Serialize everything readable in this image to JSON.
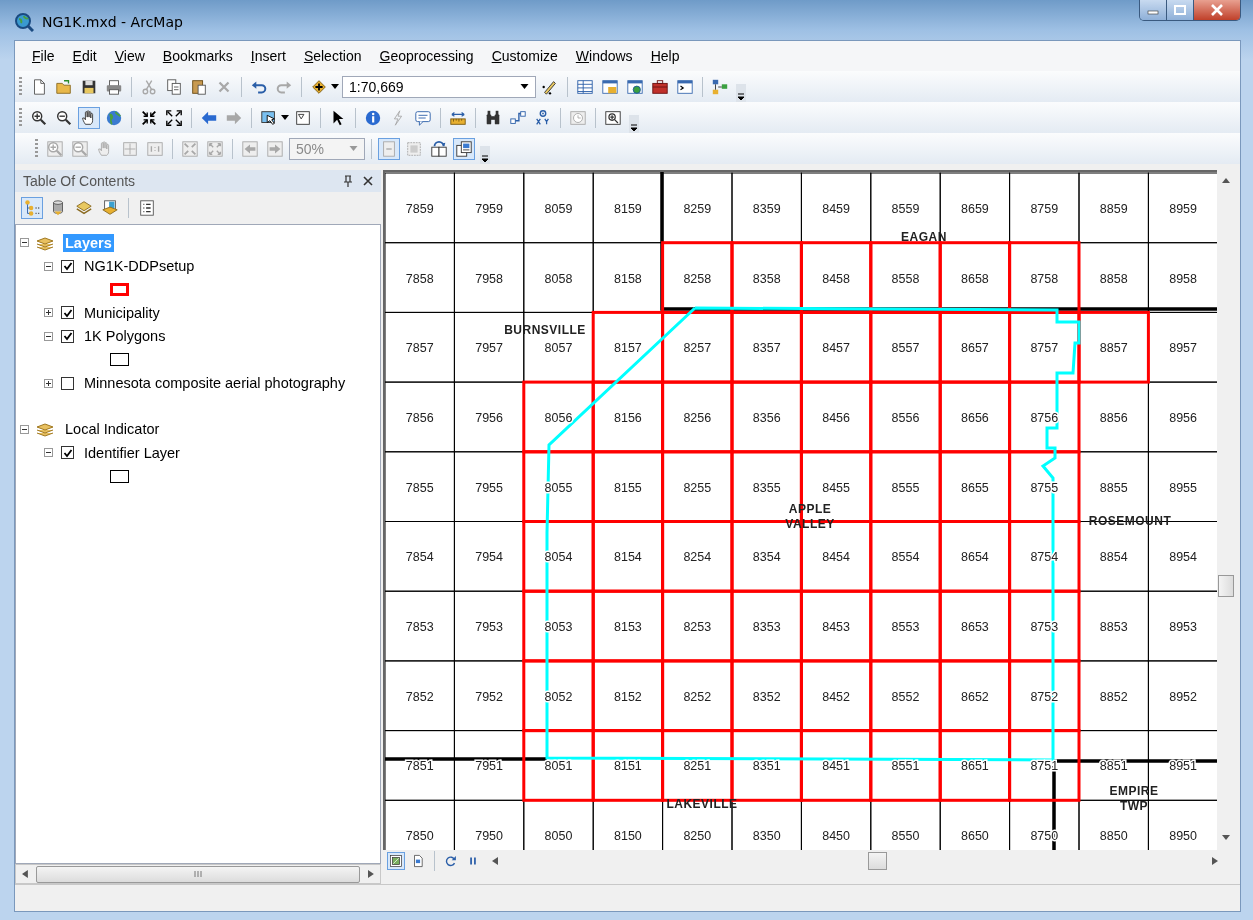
{
  "window": {
    "title": "NG1K.mxd - ArcMap"
  },
  "menu": [
    {
      "label": "File"
    },
    {
      "label": "Edit"
    },
    {
      "label": "View"
    },
    {
      "label": "Bookmarks"
    },
    {
      "label": "Insert"
    },
    {
      "label": "Selection"
    },
    {
      "label": "Geoprocessing"
    },
    {
      "label": "Customize"
    },
    {
      "label": "Windows"
    },
    {
      "label": "Help"
    }
  ],
  "standard_toolbar": {
    "scale": "1:70,669"
  },
  "layout_toolbar": {
    "zoom": "50%"
  },
  "toc": {
    "title": "Table Of Contents",
    "items": [
      {
        "label": "Layers",
        "kind": "group",
        "selected": true,
        "expanded": true,
        "children": [
          {
            "label": "NG1K-DDPsetup",
            "kind": "layer",
            "checked": true,
            "expanded": true,
            "children": [
              {
                "kind": "symbol",
                "color": "#ff0000"
              }
            ]
          },
          {
            "label": "Municipality",
            "kind": "layer",
            "checked": true,
            "expanded": false
          },
          {
            "label": "1K Polygons",
            "kind": "layer",
            "checked": true,
            "expanded": true,
            "children": [
              {
                "kind": "symbol",
                "color": "#000000"
              }
            ]
          },
          {
            "label": "Minnesota composite aerial photography",
            "kind": "layer",
            "checked": false,
            "expanded": false
          }
        ]
      },
      {
        "label": "Local Indicator",
        "kind": "group",
        "selected": false,
        "expanded": true,
        "children": [
          {
            "label": "Identifier Layer",
            "kind": "layer",
            "checked": true,
            "expanded": true,
            "children": [
              {
                "kind": "symbol",
                "color": "#000000"
              }
            ]
          }
        ]
      }
    ]
  },
  "map": {
    "rows": [
      {
        "labels": [
          "7859",
          "7959",
          "8059",
          "8159",
          "8259",
          "8359",
          "8459",
          "8559",
          "8659",
          "8759",
          "8859",
          "8959"
        ],
        "highlighted": [
          false,
          false,
          false,
          false,
          false,
          false,
          false,
          false,
          false,
          false,
          false,
          false
        ]
      },
      {
        "labels": [
          "7858",
          "7958",
          "8058",
          "8158",
          "8258",
          "8358",
          "8458",
          "8558",
          "8658",
          "8758",
          "8858",
          "8958"
        ],
        "highlighted": [
          false,
          false,
          false,
          false,
          true,
          true,
          true,
          true,
          true,
          true,
          false,
          false
        ]
      },
      {
        "labels": [
          "7857",
          "7957",
          "8057",
          "8157",
          "8257",
          "8357",
          "8457",
          "8557",
          "8657",
          "8757",
          "8857",
          "8957"
        ],
        "highlighted": [
          false,
          false,
          false,
          true,
          true,
          true,
          true,
          true,
          true,
          true,
          true,
          false
        ]
      },
      {
        "labels": [
          "7856",
          "7956",
          "8056",
          "8156",
          "8256",
          "8356",
          "8456",
          "8556",
          "8656",
          "8756",
          "8856",
          "8956"
        ],
        "highlighted": [
          false,
          false,
          true,
          true,
          true,
          true,
          true,
          true,
          true,
          true,
          false,
          false
        ]
      },
      {
        "labels": [
          "7855",
          "7955",
          "8055",
          "8155",
          "8255",
          "8355",
          "8455",
          "8555",
          "8655",
          "8755",
          "8855",
          "8955"
        ],
        "highlighted": [
          false,
          false,
          true,
          true,
          true,
          true,
          true,
          true,
          true,
          true,
          false,
          false
        ]
      },
      {
        "labels": [
          "7854",
          "7954",
          "8054",
          "8154",
          "8254",
          "8354",
          "8454",
          "8554",
          "8654",
          "8754",
          "8854",
          "8954"
        ],
        "highlighted": [
          false,
          false,
          true,
          true,
          true,
          true,
          true,
          true,
          true,
          true,
          false,
          false
        ]
      },
      {
        "labels": [
          "7853",
          "7953",
          "8053",
          "8153",
          "8253",
          "8353",
          "8453",
          "8553",
          "8653",
          "8753",
          "8853",
          "8953"
        ],
        "highlighted": [
          false,
          false,
          true,
          true,
          true,
          true,
          true,
          true,
          true,
          true,
          false,
          false
        ]
      },
      {
        "labels": [
          "7852",
          "7952",
          "8052",
          "8152",
          "8252",
          "8352",
          "8452",
          "8552",
          "8652",
          "8752",
          "8852",
          "8952"
        ],
        "highlighted": [
          false,
          false,
          true,
          true,
          true,
          true,
          true,
          true,
          true,
          true,
          false,
          false
        ]
      },
      {
        "labels": [
          "7851",
          "7951",
          "8051",
          "8151",
          "8251",
          "8351",
          "8451",
          "8551",
          "8651",
          "8751",
          "8851",
          "8951"
        ],
        "highlighted": [
          false,
          false,
          true,
          true,
          true,
          true,
          true,
          true,
          true,
          true,
          false,
          false
        ]
      },
      {
        "labels": [
          "7850",
          "7950",
          "8050",
          "8150",
          "8250",
          "8350",
          "8450",
          "8550",
          "8650",
          "8750",
          "8850",
          "8950"
        ],
        "highlighted": [
          false,
          false,
          false,
          false,
          false,
          false,
          false,
          false,
          false,
          false,
          false,
          false
        ]
      }
    ],
    "place_labels": [
      "EAGAN",
      "BURNSVILLE",
      "APPLE VALLEY",
      "ROSEMOUNT",
      "LAKEVILLE",
      "EMPIRE TWP"
    ]
  }
}
